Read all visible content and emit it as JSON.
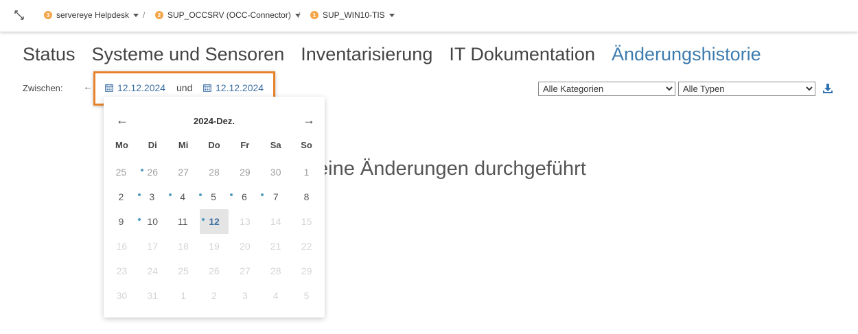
{
  "breadcrumb": [
    {
      "badge": "3",
      "label": "servereye Helpdesk"
    },
    {
      "badge": "2",
      "label": "SUP_OCCSRV (OCC-Connector)"
    },
    {
      "badge": "1",
      "label": "SUP_WIN10-TIS"
    }
  ],
  "breadcrumb_separator": "/",
  "tabs": [
    "Status",
    "Systeme und Sensoren",
    "Inventarisierung",
    "IT Dokumentation",
    "Änderungshistorie"
  ],
  "active_tab": "Änderungshistorie",
  "filter": {
    "label": "Zwischen:",
    "back_arrow": "←",
    "date_from": "12.12.2024",
    "conjunction": "und",
    "date_to": "12.12.2024",
    "category_select": "Alle Kategorien",
    "type_select": "Alle Typen"
  },
  "empty_message": "eine Änderungen durchgeführt",
  "calendar": {
    "title": "2024-Dez.",
    "prev": "←",
    "next": "→",
    "weekdays": [
      "Mo",
      "Di",
      "Mi",
      "Do",
      "Fr",
      "Sa",
      "So"
    ],
    "days": [
      {
        "d": "25",
        "s": "dim",
        "dot": true
      },
      {
        "d": "26",
        "s": "dim"
      },
      {
        "d": "27",
        "s": "dim"
      },
      {
        "d": "28",
        "s": "dim"
      },
      {
        "d": "29",
        "s": "dim"
      },
      {
        "d": "30",
        "s": "dim"
      },
      {
        "d": "1",
        "s": "dim"
      },
      {
        "d": "2",
        "s": "norm",
        "dot": true
      },
      {
        "d": "3",
        "s": "norm",
        "dot": true
      },
      {
        "d": "4",
        "s": "norm",
        "dot": true
      },
      {
        "d": "5",
        "s": "norm",
        "dot": true
      },
      {
        "d": "6",
        "s": "norm",
        "dot": true
      },
      {
        "d": "7",
        "s": "norm"
      },
      {
        "d": "8",
        "s": "norm"
      },
      {
        "d": "9",
        "s": "norm",
        "dot": true
      },
      {
        "d": "10",
        "s": "norm"
      },
      {
        "d": "11",
        "s": "norm",
        "dot": true
      },
      {
        "d": "12",
        "s": "selected"
      },
      {
        "d": "13",
        "s": "fade"
      },
      {
        "d": "14",
        "s": "fade"
      },
      {
        "d": "15",
        "s": "fade"
      },
      {
        "d": "16",
        "s": "fade"
      },
      {
        "d": "17",
        "s": "fade"
      },
      {
        "d": "18",
        "s": "fade"
      },
      {
        "d": "19",
        "s": "fade"
      },
      {
        "d": "20",
        "s": "fade"
      },
      {
        "d": "21",
        "s": "fade"
      },
      {
        "d": "22",
        "s": "fade"
      },
      {
        "d": "23",
        "s": "fade"
      },
      {
        "d": "24",
        "s": "fade"
      },
      {
        "d": "25",
        "s": "fade"
      },
      {
        "d": "26",
        "s": "fade"
      },
      {
        "d": "27",
        "s": "fade"
      },
      {
        "d": "28",
        "s": "fade"
      },
      {
        "d": "29",
        "s": "fade"
      },
      {
        "d": "30",
        "s": "fade"
      },
      {
        "d": "31",
        "s": "fade"
      },
      {
        "d": "1",
        "s": "fade"
      },
      {
        "d": "2",
        "s": "fade"
      },
      {
        "d": "3",
        "s": "fade"
      },
      {
        "d": "4",
        "s": "fade"
      },
      {
        "d": "5",
        "s": "fade"
      }
    ]
  },
  "colors": {
    "accent": "#3d7cb0",
    "highlight_box": "#e8822a",
    "badge": "#f4a64a",
    "event_dot": "#4f9bbf"
  },
  "icons": [
    "expand-icon",
    "calendar-icon",
    "download-icon",
    "chevron-down-icon"
  ]
}
